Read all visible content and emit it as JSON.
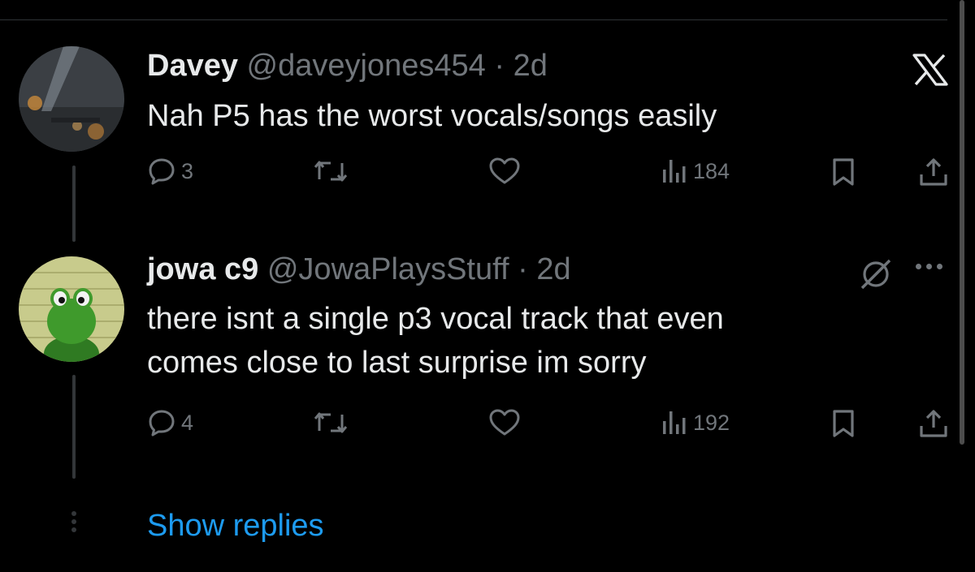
{
  "tweets": [
    {
      "name": "Davey",
      "handle": "@daveyjones454",
      "separator": "·",
      "time": "2d",
      "text": "Nah P5 has the worst vocals/songs easily",
      "stats": {
        "replies": "3",
        "views": "184"
      }
    },
    {
      "name": "jowa c9",
      "handle": "@JowaPlaysStuff",
      "separator": "·",
      "time": "2d",
      "text_lines": [
        "there isnt a single p3 vocal track that even",
        "comes close to last surprise im sorry"
      ],
      "stats": {
        "replies": "4",
        "views": "192"
      }
    }
  ],
  "show_replies": "Show replies",
  "colors": {
    "background": "#000000",
    "text": "#e7e9ea",
    "muted": "#71767b",
    "link": "#1d9bf0",
    "thread": "#333639"
  },
  "icons": [
    "x-logo-icon",
    "grok-icon",
    "more-icon",
    "reply-icon",
    "repost-icon",
    "like-icon",
    "views-icon",
    "bookmark-icon",
    "share-icon"
  ]
}
